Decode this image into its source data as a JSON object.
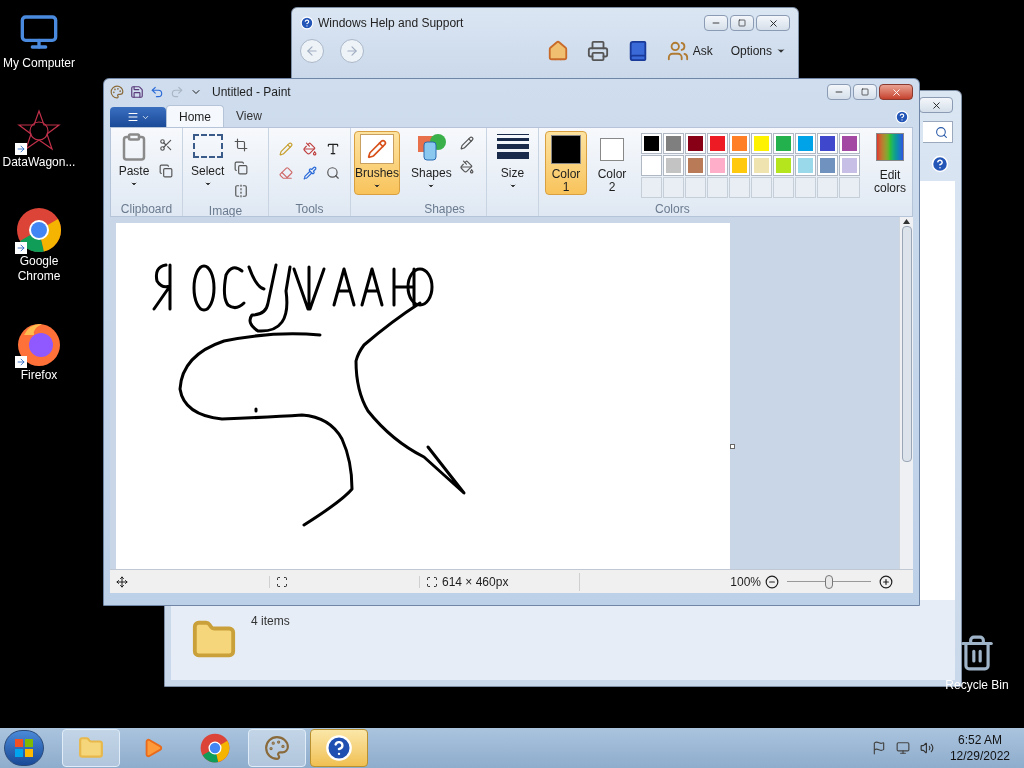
{
  "desktop_icons": [
    {
      "kind": "computer",
      "label": "My Computer",
      "shortcut": false
    },
    {
      "kind": "datawagon",
      "label": "DataWagon...",
      "shortcut": true
    },
    {
      "kind": "chrome",
      "label": "Google Chrome",
      "shortcut": true
    },
    {
      "kind": "firefox",
      "label": "Firefox",
      "shortcut": true
    }
  ],
  "recycle_bin": {
    "label": "Recycle Bin"
  },
  "help_window": {
    "title": "Windows Help and Support",
    "toolbar": {
      "ask": "Ask",
      "options": "Options"
    }
  },
  "explorer_window": {
    "status": "4 items"
  },
  "paint": {
    "title": "Untitled - Paint",
    "tabs": [
      {
        "label": "Home",
        "selected": true
      },
      {
        "label": "View",
        "selected": false
      }
    ],
    "groups": {
      "clipboard": {
        "title": "Clipboard",
        "paste": "Paste"
      },
      "image": {
        "title": "Image",
        "select": "Select"
      },
      "tools": {
        "title": "Tools"
      },
      "brushes": {
        "label": "Brushes",
        "selected": true
      },
      "shapes": {
        "title": "Shapes",
        "label": "Shapes"
      },
      "size": {
        "label": "Size"
      },
      "colors": {
        "title": "Colors",
        "color1": {
          "label": "Color 1",
          "selected": true,
          "color": "#000000"
        },
        "color2": {
          "label": "Color 2",
          "selected": false,
          "color": "#ffffff"
        },
        "edit": "Edit colors",
        "palette": [
          {
            "color": "#000000"
          },
          {
            "color": "#7f7f7f"
          },
          {
            "color": "#880015"
          },
          {
            "color": "#ed1c24"
          },
          {
            "color": "#ff7f27"
          },
          {
            "color": "#fff200"
          },
          {
            "color": "#22b14c"
          },
          {
            "color": "#00a2e8"
          },
          {
            "color": "#3f48cc"
          },
          {
            "color": "#a349a4"
          },
          {
            "color": "#ffffff"
          },
          {
            "color": "#c3c3c3"
          },
          {
            "color": "#b97a57"
          },
          {
            "color": "#ffaec9"
          },
          {
            "color": "#ffc90e"
          },
          {
            "color": "#efe4b0"
          },
          {
            "color": "#b5e61d"
          },
          {
            "color": "#99d9ea"
          },
          {
            "color": "#7092be"
          },
          {
            "color": "#c8bfe7"
          }
        ]
      }
    },
    "status_bar": {
      "image_size": "614 × 460px",
      "zoom": "100%",
      "zoom_slider": {
        "level": 0.5
      }
    }
  },
  "taskbar": {
    "items": [
      {
        "kind": "explorer",
        "selected": false
      },
      {
        "kind": "media",
        "selected": false
      },
      {
        "kind": "chrome",
        "selected": false
      },
      {
        "kind": "paint",
        "selected": false
      },
      {
        "kind": "help",
        "selected": true
      }
    ],
    "time": "6:52 AM",
    "date": "12/29/2022"
  }
}
